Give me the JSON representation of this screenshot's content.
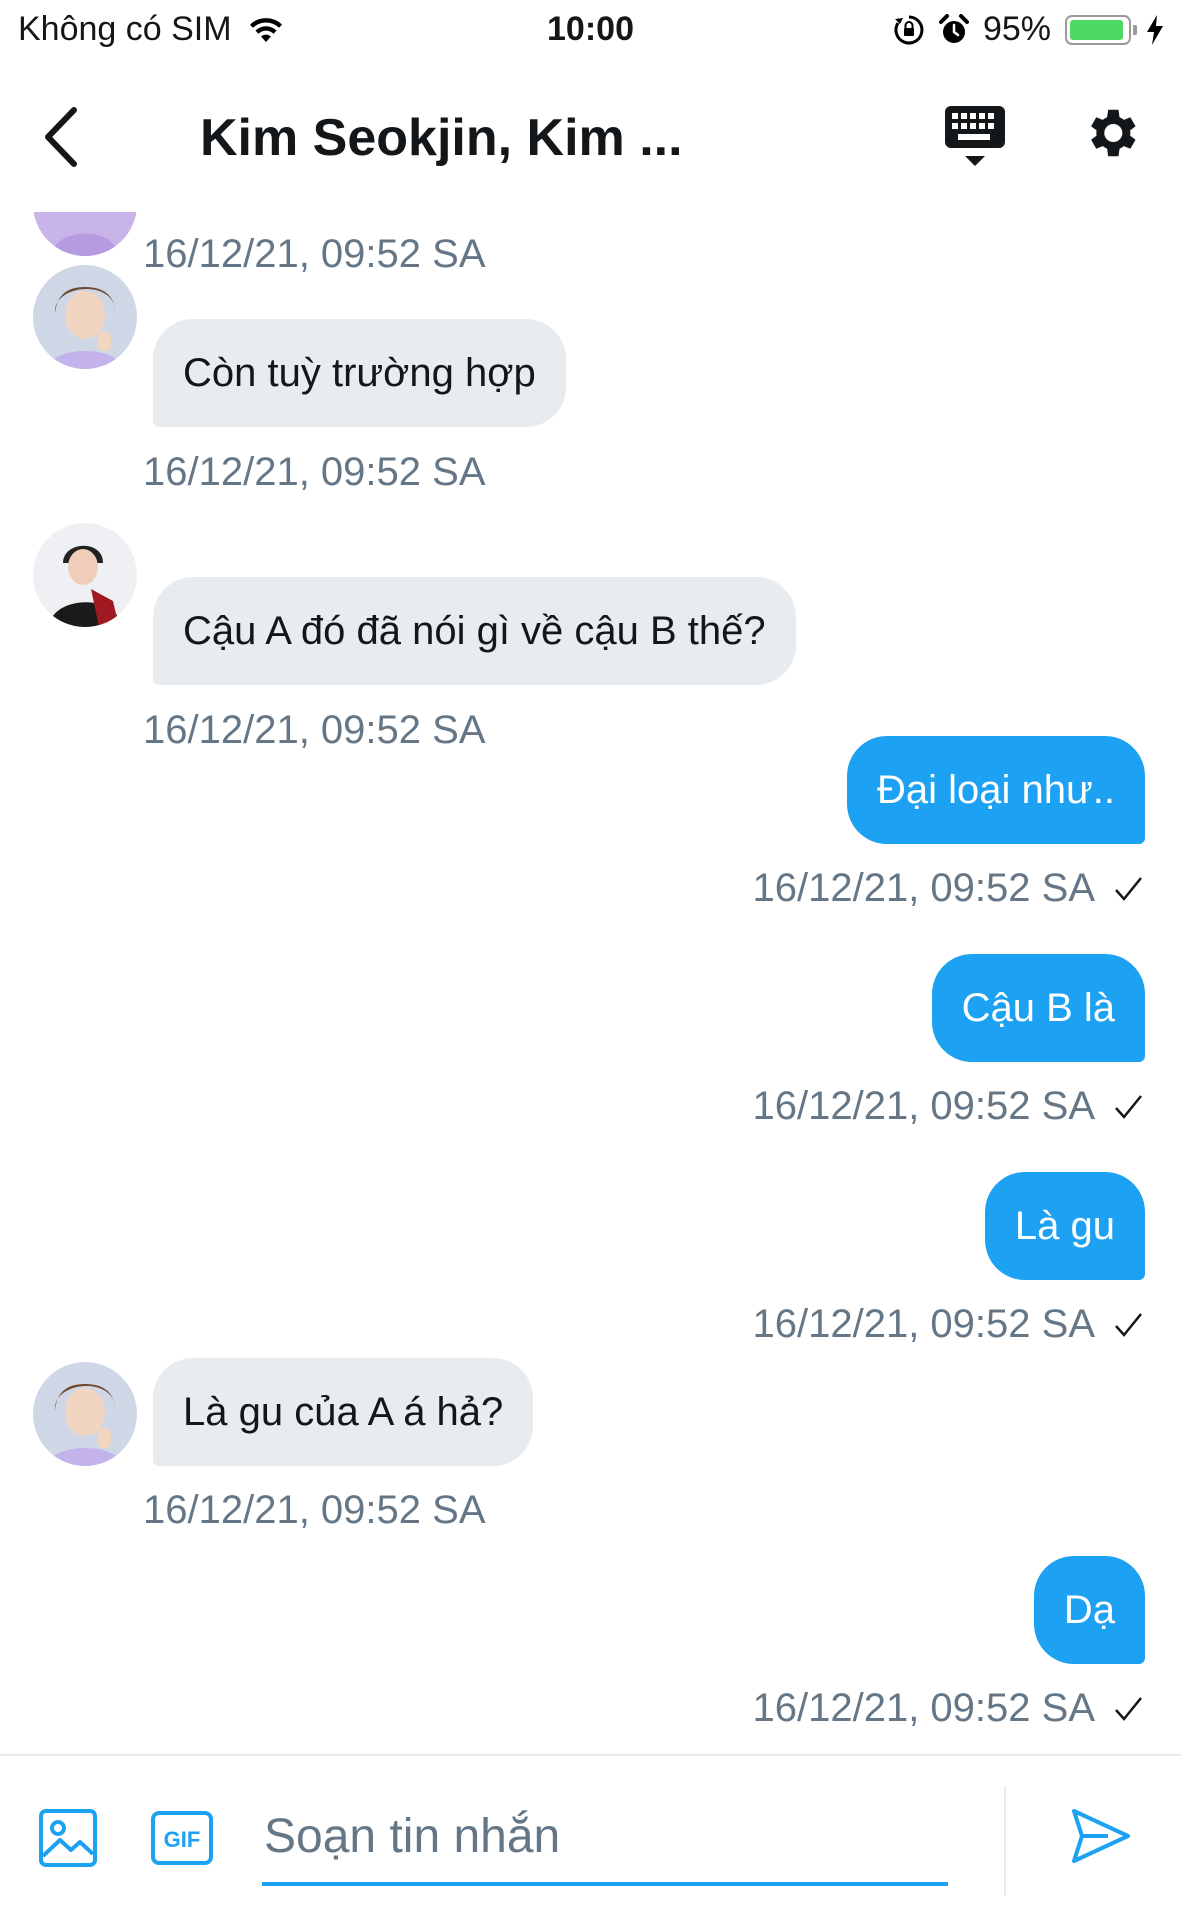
{
  "status_bar": {
    "carrier": "Không có SIM",
    "time": "10:00",
    "battery_percent": "95%",
    "battery_level": 0.95
  },
  "header": {
    "title": "Kim Seokjin, Kim ...",
    "icons": [
      "back-chevron-icon",
      "keyboard-icon",
      "gear-icon"
    ]
  },
  "messages": [
    {
      "direction": "in",
      "text": "",
      "timestamp": "16/12/21, 09:52 SA"
    },
    {
      "direction": "in",
      "text": "Còn tuỳ trường hợp",
      "timestamp": "16/12/21, 09:52 SA"
    },
    {
      "direction": "in",
      "text": "Cậu A đó đã nói gì về cậu B thế?",
      "timestamp": "16/12/21, 09:52 SA"
    },
    {
      "direction": "out",
      "text": "Đại loại như..",
      "timestamp": "16/12/21, 09:52 SA"
    },
    {
      "direction": "out",
      "text": "Cậu B là",
      "timestamp": "16/12/21, 09:52 SA"
    },
    {
      "direction": "out",
      "text": "Là gu",
      "timestamp": "16/12/21, 09:52 SA"
    },
    {
      "direction": "in",
      "text": "Là gu của A á hả?",
      "timestamp": "16/12/21, 09:52 SA"
    },
    {
      "direction": "out",
      "text": "Dạ",
      "timestamp": "16/12/21, 09:52 SA"
    }
  ],
  "composer": {
    "placeholder": "Soạn tin nhắn",
    "value": "",
    "icons": [
      "image-icon",
      "gif-icon",
      "send-icon"
    ]
  },
  "colors": {
    "accent": "#1da1f2",
    "incoming_bubble": "#e6ecf0",
    "timestamp": "#657786",
    "battery": "#4cd964"
  }
}
